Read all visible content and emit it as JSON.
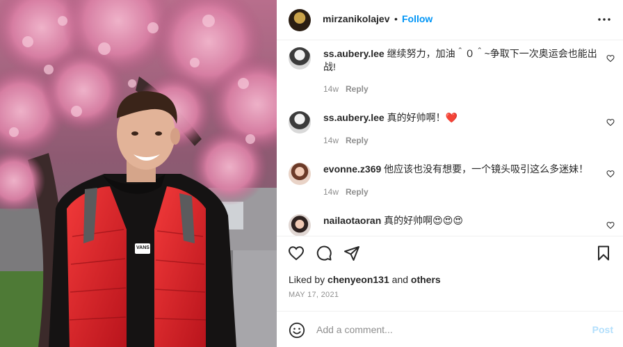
{
  "post": {
    "username": "mirzanikolajev",
    "separator": "•",
    "follow_label": "Follow",
    "more_icon": "more-horizontal-icon"
  },
  "comments": [
    {
      "user": "ss.aubery.lee",
      "text": "继续努力，加油＾０＾~争取下一次奥运会也能出战!",
      "time": "14w",
      "reply": "Reply"
    },
    {
      "user": "ss.aubery.lee",
      "text": "真的好帅啊！❤️",
      "time": "14w",
      "reply": "Reply"
    },
    {
      "user": "evonne.z369",
      "text": "他应该也没有想要，一个镜头吸引这么多迷妹！",
      "time": "14w",
      "reply": "Reply"
    },
    {
      "user": "nailaotaoran",
      "text": "真的好帅啊😍😍😍",
      "time": "",
      "reply": ""
    }
  ],
  "actions": {
    "like_icon": "heart-icon",
    "comment_icon": "comment-icon",
    "share_icon": "share-icon",
    "save_icon": "bookmark-icon"
  },
  "likes": {
    "prefix": "Liked by",
    "user": "chenyeon131",
    "joiner": "and",
    "others": "others"
  },
  "date": "MAY 17, 2021",
  "add_comment": {
    "placeholder": "Add a comment...",
    "post_label": "Post",
    "emoji_icon": "smiley-icon"
  },
  "photo": {
    "shirt_logo": "VANS"
  },
  "colors": {
    "link_blue": "#0095f6",
    "post_disabled": "#b2dffc",
    "muted": "#8e8e8e",
    "text": "#262626",
    "heart_red": "#ed4956"
  }
}
